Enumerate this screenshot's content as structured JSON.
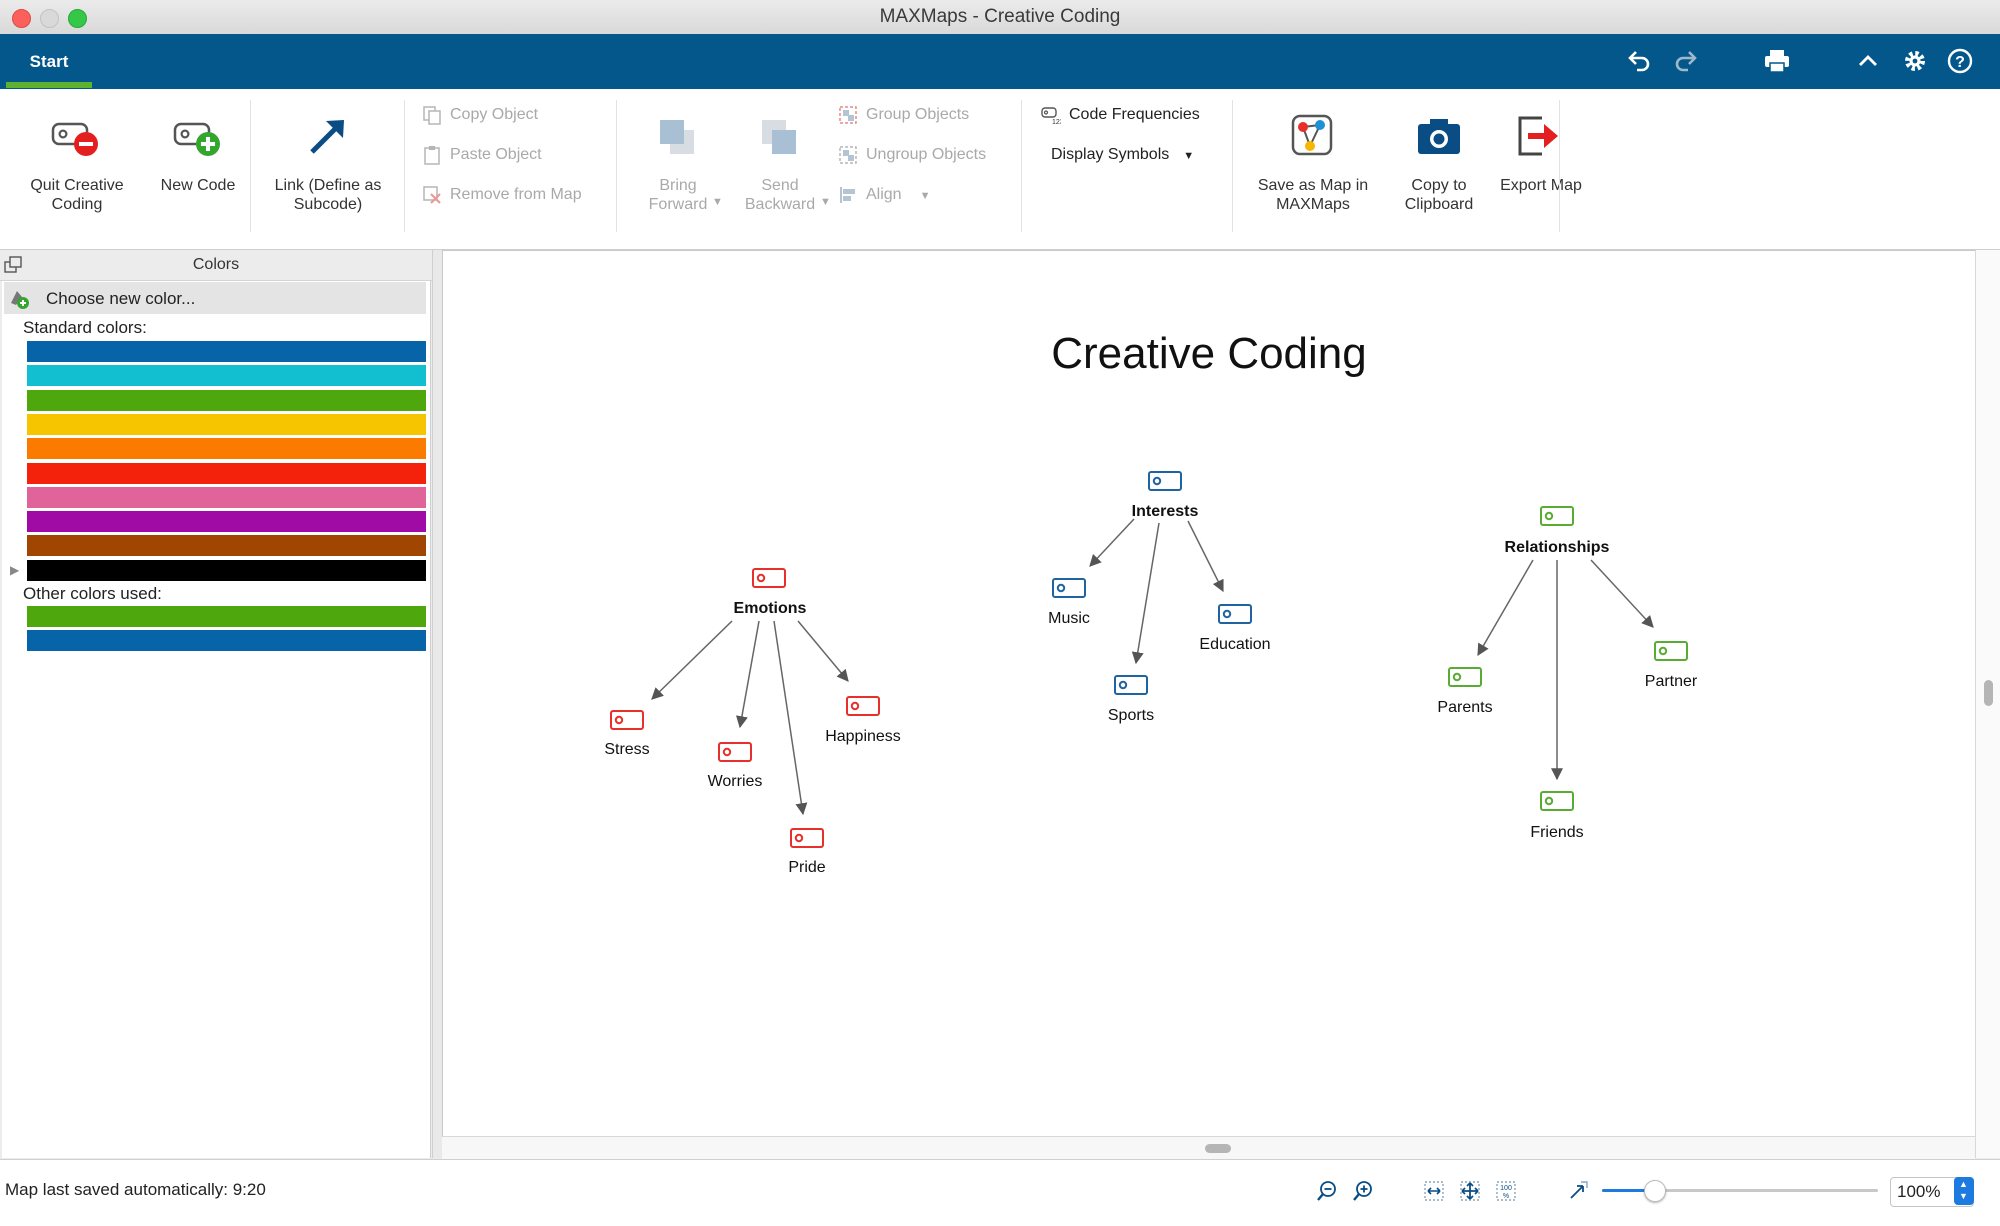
{
  "window": {
    "title": "MAXMaps - Creative Coding"
  },
  "tabs": {
    "start": "Start"
  },
  "ribbon": {
    "quit_label": "Quit Creative Coding",
    "new_code_label": "New Code",
    "link_label": "Link (Define as Subcode)",
    "copy_object": "Copy Object",
    "paste_object": "Paste Object",
    "remove_from_map": "Remove from Map",
    "bring_forward": "Bring Forward",
    "send_backward": "Send Backward",
    "group_objects": "Group Objects",
    "ungroup_objects": "Ungroup Objects",
    "align": "Align",
    "code_frequencies": "Code Frequencies",
    "display_symbols": "Display Symbols",
    "save_as_map": "Save as Map in MAXMaps",
    "copy_clipboard": "Copy to Clipboard",
    "export_map": "Export Map"
  },
  "colors_panel": {
    "title": "Colors",
    "choose_new": "Choose new color...",
    "standard_label": "Standard colors:",
    "standard_colors": [
      "#0864a8",
      "#12bfd0",
      "#4ea70c",
      "#f7c500",
      "#fb7a00",
      "#f5220b",
      "#e0649a",
      "#a00aa5",
      "#a04600",
      "#000000"
    ],
    "other_label": "Other colors used:",
    "other_colors": [
      "#4ea70c",
      "#0864a8"
    ]
  },
  "map": {
    "title": "Creative Coding",
    "colors": {
      "red": "#e8302a",
      "blue": "#1f63a0",
      "green": "#59ac32"
    },
    "groups": {
      "emotions": {
        "parent": "Emotions",
        "children": [
          "Stress",
          "Worries",
          "Pride",
          "Happiness"
        ]
      },
      "interests": {
        "parent": "Interests",
        "children": [
          "Music",
          "Sports",
          "Education"
        ]
      },
      "relationships": {
        "parent": "Relationships",
        "children": [
          "Parents",
          "Friends",
          "Partner"
        ]
      }
    }
  },
  "status": {
    "text": "Map last saved automatically: 9:20",
    "zoom": "100%",
    "zoom_level": 0.19
  }
}
